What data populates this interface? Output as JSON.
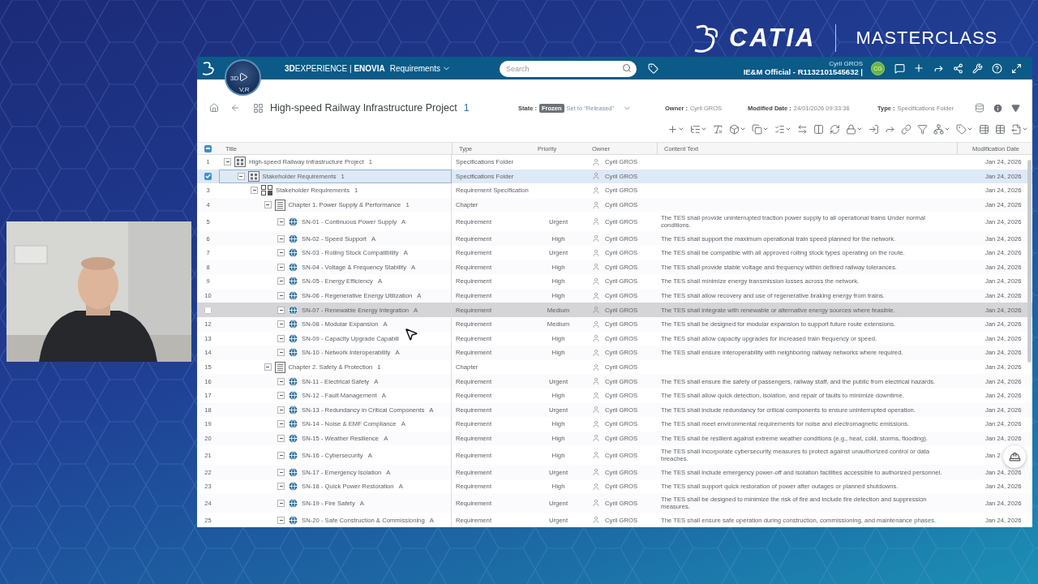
{
  "brand": {
    "name": "CATIA",
    "tagline": "MASTERCLASS"
  },
  "topbar": {
    "compass_labels": [
      "3D",
      "V,R"
    ],
    "platform": "**3D**EXPERIENCE | **ENOVIA**",
    "module": "Requirements",
    "search": {
      "placeholder": "Search"
    },
    "user": {
      "name": "Cyril GROS",
      "context": "IE&M Official - R1132101545632 |",
      "initials": "CG"
    }
  },
  "header": {
    "title": "High-speed Railway Infrastructure Project",
    "revision": "1",
    "state_label": "State :",
    "state": "Frozen",
    "state_action": "Set to \"Released\"",
    "owner_label": "Owner :",
    "owner": "Cyril GROS",
    "modified_label": "Modified Date :",
    "modified": "24/01/2026 09:33:36",
    "type_label": "Type :",
    "type": "Specifications Folder"
  },
  "table": {
    "select_all": {
      "indeterminate": true
    },
    "columns": [
      "Title",
      "Type",
      "Priority",
      "Owner",
      "Content Text",
      "Modification Date"
    ],
    "rows": [
      {
        "number": "1",
        "kind": "folder",
        "title": "High-speed Railway Infrastructure Project",
        "revision": "1",
        "type": "Specifications Folder",
        "owner": "Cyril GROS",
        "date": "Jan 24, 2026",
        "expanded": true,
        "selected": false,
        "hovered": false,
        "children": [
          {
            "kind": "folder",
            "title": "Stakeholder Requirements",
            "revision": "1",
            "type": "Specifications Folder",
            "owner": "Cyril GROS",
            "date": "Jan 24, 2026",
            "expanded": true,
            "selected": true,
            "hovered": false,
            "children": [
              {
                "number": "3",
                "kind": "specification",
                "title": "Stakeholder Requirements",
                "revision": "1",
                "type": "Requirement Specification",
                "owner": "Cyril GROS",
                "date": "Jan 24, 2026",
                "expanded": true,
                "selected": false,
                "hovered": false,
                "children": [
                  {
                    "number": "4",
                    "kind": "chapter",
                    "title": "Chapter 1. Power Supply & Performance",
                    "revision": "1",
                    "type": "Chapter",
                    "owner": "Cyril GROS",
                    "date": "Jan 24, 2026",
                    "expanded": true,
                    "selected": false,
                    "hovered": false,
                    "children": [
                      {
                        "number": "5",
                        "kind": "requirement",
                        "title": "SN-01 - Continuous Power Supply",
                        "revision": "A",
                        "type": "Requirement",
                        "priority": "Urgent",
                        "owner": "Cyril GROS",
                        "content": "The TES shall provide uninterrupted traction power supply to all operational trains Under normal conditions.",
                        "date": "Jan 24, 2026",
                        "expanded": true,
                        "selected": false,
                        "hovered": false
                      },
                      {
                        "number": "6",
                        "kind": "requirement",
                        "title": "SN-02 - Speed Support",
                        "revision": "A",
                        "type": "Requirement",
                        "priority": "High",
                        "owner": "Cyril GROS",
                        "content": "The TES shall support the maximum operational train speed planned for the network.",
                        "date": "Jan 24, 2026",
                        "expanded": true,
                        "selected": false,
                        "hovered": false
                      },
                      {
                        "number": "7",
                        "kind": "requirement",
                        "title": "SN-03 - Rolling Stock Compatibility",
                        "revision": "A",
                        "type": "Requirement",
                        "priority": "Urgent",
                        "owner": "Cyril GROS",
                        "content": "The TES shall be compatible with all approved rolling stock types operating on the route.",
                        "date": "Jan 24, 2026",
                        "expanded": true,
                        "selected": false,
                        "hovered": false
                      },
                      {
                        "number": "8",
                        "kind": "requirement",
                        "title": "SN-04 - Voltage & Frequency Stability",
                        "revision": "A",
                        "type": "Requirement",
                        "priority": "High",
                        "owner": "Cyril GROS",
                        "content": "The TES shall provide stable voltage and frequency within defined railway tolerances.",
                        "date": "Jan 24, 2026",
                        "expanded": true,
                        "selected": false,
                        "hovered": false
                      },
                      {
                        "number": "9",
                        "kind": "requirement",
                        "title": "SN-05 - Energy Efficiency",
                        "revision": "A",
                        "type": "Requirement",
                        "priority": "High",
                        "owner": "Cyril GROS",
                        "content": "The TES shall minimize energy transmission losses across the network.",
                        "date": "Jan 24, 2026",
                        "expanded": true,
                        "selected": false,
                        "hovered": false
                      },
                      {
                        "number": "10",
                        "kind": "requirement",
                        "title": "SN-06 - Regenerative Energy Utilization",
                        "revision": "A",
                        "type": "Requirement",
                        "priority": "High",
                        "owner": "Cyril GROS",
                        "content": "The TES shall allow recovery and use of regenerative braking energy from trains.",
                        "date": "Jan 24, 2026",
                        "expanded": true,
                        "selected": false,
                        "hovered": false
                      },
                      {
                        "kind": "requirement",
                        "title": "SN-07 - Renewable Energy Integration",
                        "revision": "A",
                        "type": "Requirement",
                        "priority": "Medium",
                        "owner": "Cyril GROS",
                        "content": "The TES shall integrate with renewable or alternative energy sources where feasible.",
                        "date": "Jan 24, 2026",
                        "expanded": true,
                        "selected": false,
                        "hovered": true
                      },
                      {
                        "number": "12",
                        "kind": "requirement",
                        "title": "SN-08 - Modular Expansion",
                        "revision": "A",
                        "type": "Requirement",
                        "priority": "Medium",
                        "owner": "Cyril GROS",
                        "content": "The TES shall be designed for modular expansion to support future route extensions.",
                        "date": "Jan 24, 2026",
                        "expanded": true,
                        "selected": false,
                        "hovered": false
                      },
                      {
                        "number": "13",
                        "kind": "requirement",
                        "title": "SN-09 - Capacity Upgrade Capabili",
                        "type": "Requirement",
                        "priority": "High",
                        "owner": "Cyril GROS",
                        "content": "The TES shall allow capacity upgrades for increased train frequency or speed.",
                        "date": "Jan 24, 2026",
                        "expanded": true,
                        "selected": false,
                        "hovered": false
                      },
                      {
                        "number": "14",
                        "kind": "requirement",
                        "title": "SN-10 - Network Interoperability",
                        "revision": "A",
                        "type": "Requirement",
                        "priority": "High",
                        "owner": "Cyril GROS",
                        "content": "The TES shall ensure interoperability with neighboring railway networks where required.",
                        "date": "Jan 24, 2026",
                        "expanded": true,
                        "selected": false,
                        "hovered": false
                      }
                    ]
                  },
                  {
                    "number": "15",
                    "kind": "chapter",
                    "title": "Chapter 2. Safety & Protection",
                    "revision": "1",
                    "type": "Chapter",
                    "owner": "Cyril GROS",
                    "date": "Jan 24, 2026",
                    "expanded": true,
                    "selected": false,
                    "hovered": false,
                    "children": [
                      {
                        "number": "16",
                        "kind": "requirement",
                        "title": "SN-11 - Electrical Safety",
                        "revision": "A",
                        "type": "Requirement",
                        "priority": "Urgent",
                        "owner": "Cyril GROS",
                        "content": "The TES shall ensure the safety of passengers, railway staff, and the public from electrical hazards.",
                        "date": "Jan 24, 2026",
                        "expanded": true,
                        "selected": false,
                        "hovered": false
                      },
                      {
                        "number": "17",
                        "kind": "requirement",
                        "title": "SN-12 - Fault Management",
                        "revision": "A",
                        "type": "Requirement",
                        "priority": "High",
                        "owner": "Cyril GROS",
                        "content": "The TES shall allow quick detection, isolation, and repair of faults to minimize downtime.",
                        "date": "Jan 24, 2026",
                        "expanded": true,
                        "selected": false,
                        "hovered": false
                      },
                      {
                        "number": "18",
                        "kind": "requirement",
                        "title": "SN-13 - Redundancy in Critical Components",
                        "revision": "A",
                        "type": "Requirement",
                        "priority": "Urgent",
                        "owner": "Cyril GROS",
                        "content": "The TES shall include redundancy for critical components to ensure uninterrupted operation.",
                        "date": "Jan 24, 2026",
                        "expanded": true,
                        "selected": false,
                        "hovered": false
                      },
                      {
                        "number": "19",
                        "kind": "requirement",
                        "title": "SN-14 - Noise & EMF Compliance",
                        "revision": "A",
                        "type": "Requirement",
                        "priority": "High",
                        "owner": "Cyril GROS",
                        "content": "The TES shall meet environmental requirements for noise and electromagnetic emissions.",
                        "date": "Jan 24, 2026",
                        "expanded": true,
                        "selected": false,
                        "hovered": false
                      },
                      {
                        "number": "20",
                        "kind": "requirement",
                        "title": "SN-15 - Weather Resilience",
                        "revision": "A",
                        "type": "Requirement",
                        "priority": "High",
                        "owner": "Cyril GROS",
                        "content": "The TES shall be resilient against extreme weather conditions (e.g., heat, cold, storms, flooding).",
                        "date": "Jan 24, 2026",
                        "expanded": true,
                        "selected": false,
                        "hovered": false
                      },
                      {
                        "number": "21",
                        "kind": "requirement",
                        "title": "SN-16 - Cybersecurity",
                        "revision": "A",
                        "type": "Requirement",
                        "priority": "High",
                        "owner": "Cyril GROS",
                        "content": "The TES shall incorporate cybersecurity measures to protect against unauthorized control or data breaches.",
                        "date": "Jan 2",
                        "expanded": true,
                        "selected": false,
                        "hovered": false
                      },
                      {
                        "number": "22",
                        "kind": "requirement",
                        "title": "SN-17 - Emergency Isolation",
                        "revision": "A",
                        "type": "Requirement",
                        "priority": "Urgent",
                        "owner": "Cyril GROS",
                        "content": "The TES shall include emergency power-off and isolation facilities accessible to authorized personnel.",
                        "date": "Jan 24, 2026",
                        "expanded": true,
                        "selected": false,
                        "hovered": false
                      },
                      {
                        "number": "23",
                        "kind": "requirement",
                        "title": "SN-18 - Quick Power Restoration",
                        "revision": "A",
                        "type": "Requirement",
                        "priority": "High",
                        "owner": "Cyril GROS",
                        "content": "The TES shall support quick restoration of power after outages or planned shutdowns.",
                        "date": "Jan 24, 2026",
                        "expanded": true,
                        "selected": false,
                        "hovered": false
                      },
                      {
                        "number": "24",
                        "kind": "requirement",
                        "title": "SN-19 - Fire Safety",
                        "revision": "A",
                        "type": "Requirement",
                        "priority": "Urgent",
                        "owner": "Cyril GROS",
                        "content": "The TES shall be designed to minimize the risk of fire and include fire detection and suppression measures.",
                        "date": "Jan 24, 2026",
                        "expanded": true,
                        "selected": false,
                        "hovered": false
                      },
                      {
                        "number": "25",
                        "kind": "requirement",
                        "title": "SN-20 - Safe Construction & Commissioning",
                        "revision": "A",
                        "type": "Requirement",
                        "priority": "Urgent",
                        "owner": "Cyril GROS",
                        "content": "The TES shall ensure safe operation during construction, commissioning, and maintenance phases.",
                        "date": "Jan 24, 2026",
                        "expanded": true,
                        "selected": false,
                        "hovered": false
                      }
                    ]
                  }
                ]
              }
            ]
          }
        ]
      }
    ]
  }
}
